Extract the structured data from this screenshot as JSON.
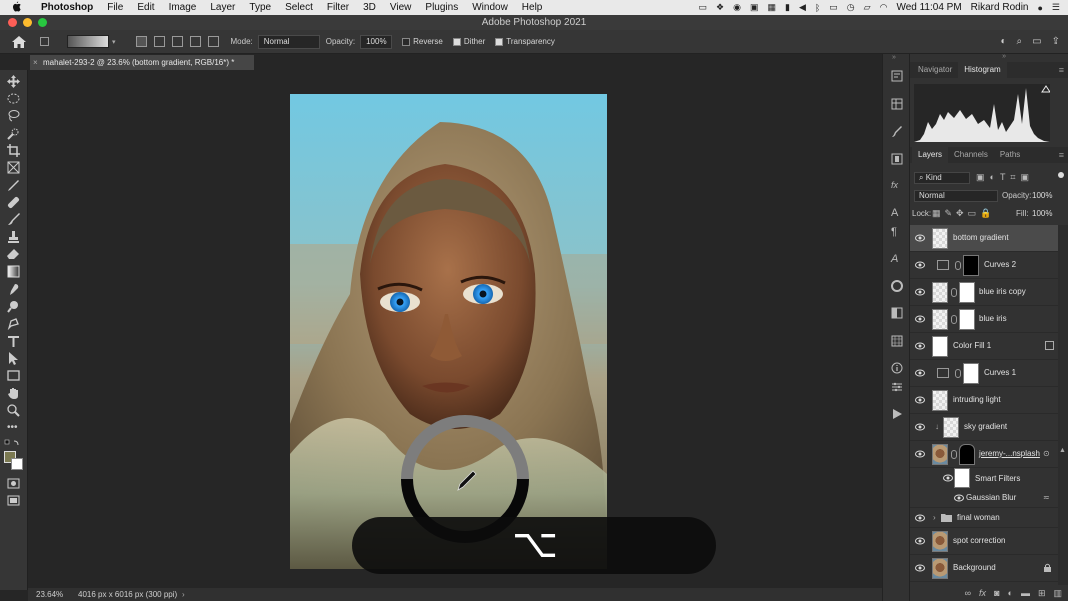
{
  "menubar": {
    "app_name": "Photoshop",
    "items": [
      "File",
      "Edit",
      "Image",
      "Layer",
      "Type",
      "Select",
      "Filter",
      "3D",
      "View",
      "Plugins",
      "Window",
      "Help"
    ],
    "clock": "Wed 11:04 PM",
    "user": "Rikard Rodin"
  },
  "window": {
    "title": "Adobe Photoshop 2021"
  },
  "options_bar": {
    "mode_label": "Mode:",
    "mode_value": "Normal",
    "opacity_label": "Opacity:",
    "opacity_value": "100%",
    "reverse_label": "Reverse",
    "reverse_checked": false,
    "dither_label": "Dither",
    "dither_checked": true,
    "transparency_label": "Transparency",
    "transparency_checked": true
  },
  "document": {
    "tab_title": "mahalet-293-2 @ 23.6% (bottom gradient, RGB/16*) *",
    "zoom": "23.64%",
    "dimensions": "4016 px x 6016 px (300 ppi)"
  },
  "panels": {
    "top_tabs": [
      "Navigator",
      "Histogram"
    ],
    "top_active": "Histogram",
    "layer_tabs": [
      "Layers",
      "Channels",
      "Paths"
    ],
    "layer_active": "Layers",
    "filter_kind": "Kind",
    "blend_mode": "Normal",
    "opacity_label": "Opacity:",
    "opacity_value": "100%",
    "lock_label": "Lock:",
    "fill_label": "Fill:",
    "fill_value": "100%"
  },
  "layers": [
    {
      "name": "bottom gradient",
      "selected": true
    },
    {
      "name": "Curves 2"
    },
    {
      "name": "blue iris copy"
    },
    {
      "name": "blue iris"
    },
    {
      "name": "Color Fill 1"
    },
    {
      "name": "Curves 1"
    },
    {
      "name": "intruding light"
    },
    {
      "name": "sky gradient"
    },
    {
      "name": "jeremy-...nsplash"
    },
    {
      "name": "Smart Filters"
    },
    {
      "name": "Gaussian Blur"
    },
    {
      "name": "final woman"
    },
    {
      "name": "spot correction"
    },
    {
      "name": "Background"
    }
  ],
  "overlay": {
    "key_glyph": "⌥"
  },
  "colors": {
    "accent": "#4b4b4b",
    "sky": "#72c8e2",
    "iris": "#2a8fe0"
  }
}
